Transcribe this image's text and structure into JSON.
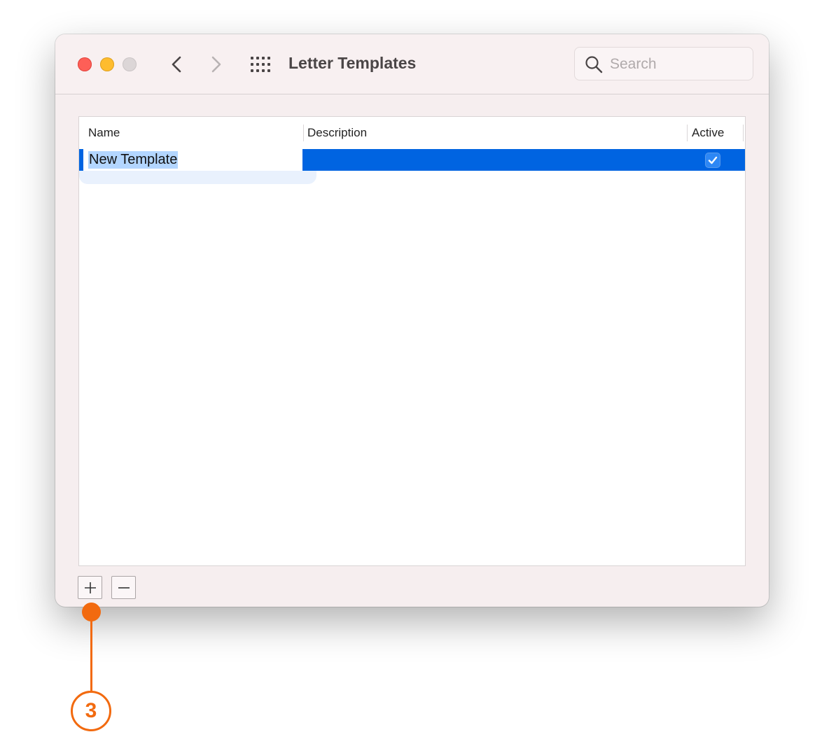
{
  "window": {
    "title": "Letter Templates"
  },
  "search": {
    "placeholder": "Search",
    "value": ""
  },
  "table": {
    "columns": [
      "Name",
      "Description",
      "Active"
    ],
    "rows": [
      {
        "name": "New Template",
        "description": "",
        "active": true
      }
    ]
  },
  "toolbar": {
    "add_label": "+",
    "remove_label": "−"
  },
  "callout": {
    "number": "3"
  },
  "colors": {
    "selection": "#0064e1",
    "text_highlight": "#b3d6ff",
    "callout": "#f26a0f"
  }
}
